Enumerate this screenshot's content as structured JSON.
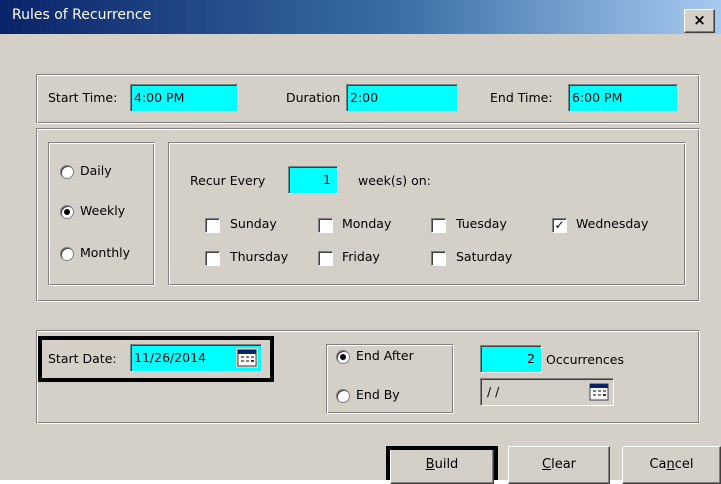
{
  "window": {
    "title": "Rules of Recurrence",
    "close_label": "×"
  },
  "time": {
    "start_label": "Start Time:",
    "start_value": "4:00 PM",
    "duration_label": "Duration",
    "duration_value": "2:00",
    "end_label": "End Time:",
    "end_value": "6:00 PM"
  },
  "frequency": {
    "options": [
      "Daily",
      "Weekly",
      "Monthly"
    ],
    "selected": "Weekly"
  },
  "recur": {
    "label": "Recur Every",
    "value": "1",
    "suffix": "week(s) on:",
    "days": [
      {
        "label": "Sunday",
        "checked": false
      },
      {
        "label": "Monday",
        "checked": false
      },
      {
        "label": "Tuesday",
        "checked": false
      },
      {
        "label": "Wednesday",
        "checked": true
      },
      {
        "label": "Thursday",
        "checked": false
      },
      {
        "label": "Friday",
        "checked": false
      },
      {
        "label": "Saturday",
        "checked": false
      }
    ]
  },
  "range": {
    "start_date_label": "Start Date:",
    "start_date_value": "11/26/2014",
    "end_after_label": "End After",
    "end_by_label": "End By",
    "end_selected": "End After",
    "occurrences_value": "2",
    "occurrences_label": "Occurrences",
    "end_by_value": "/ /"
  },
  "buttons": {
    "build_mnemonic": "B",
    "build_rest": "uild",
    "clear_mnemonic": "C",
    "clear_rest": "lear",
    "cancel_pre": "Ca",
    "cancel_mnemonic": "n",
    "cancel_post": "cel"
  },
  "colors": {
    "field_bg": "#00ffff",
    "dialog_bg": "#d4d0c8",
    "title_start": "#0a246a",
    "title_end": "#a6caf0"
  }
}
